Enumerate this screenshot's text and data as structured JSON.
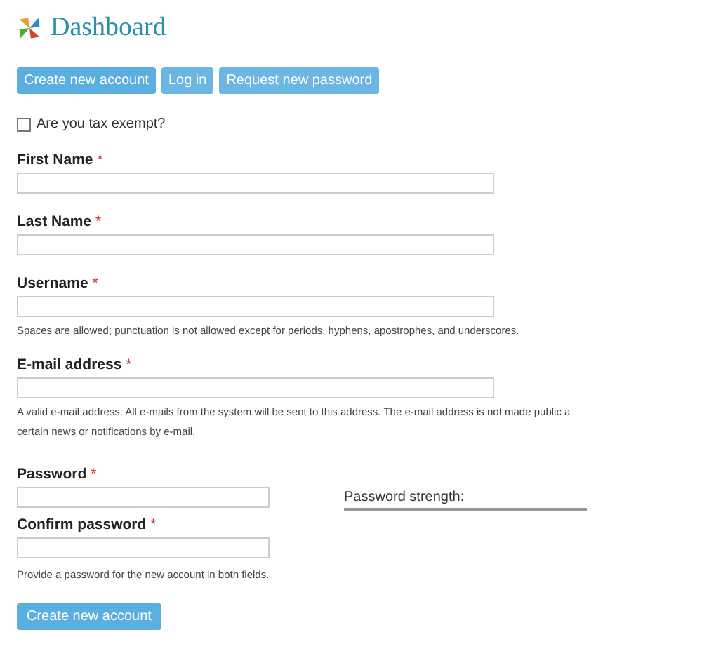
{
  "header": {
    "title": "Dashboard"
  },
  "tabs": [
    {
      "label": "Create new account",
      "selected": true
    },
    {
      "label": "Log in",
      "selected": false
    },
    {
      "label": "Request new password",
      "selected": false
    }
  ],
  "tax_exempt": {
    "label": "Are you tax exempt?",
    "checked": false
  },
  "fields": [
    {
      "kind": "text",
      "label": "First Name",
      "required_mark": "*"
    },
    {
      "kind": "text",
      "label": "Last Name",
      "required_mark": "*"
    },
    {
      "kind": "text",
      "label": "Username",
      "required_mark": "*",
      "description": [
        "Spaces are allowed; punctuation is not allowed except for periods, hyphens, apostrophes, and underscores."
      ]
    },
    {
      "kind": "text",
      "label": "E-mail address",
      "required_mark": "*",
      "description": [
        "A valid e-mail address. All e-mails from the system will be sent to this address. The e-mail address is not made public a",
        "certain news or notifications by e-mail."
      ]
    }
  ],
  "password": {
    "label": "Password",
    "required_mark": "*",
    "strength_label": "Password strength:",
    "confirm_label": "Confirm password",
    "confirm_required_mark": "*",
    "description": "Provide a password for the new account in both fields."
  },
  "submit": {
    "label": "Create new account"
  }
}
